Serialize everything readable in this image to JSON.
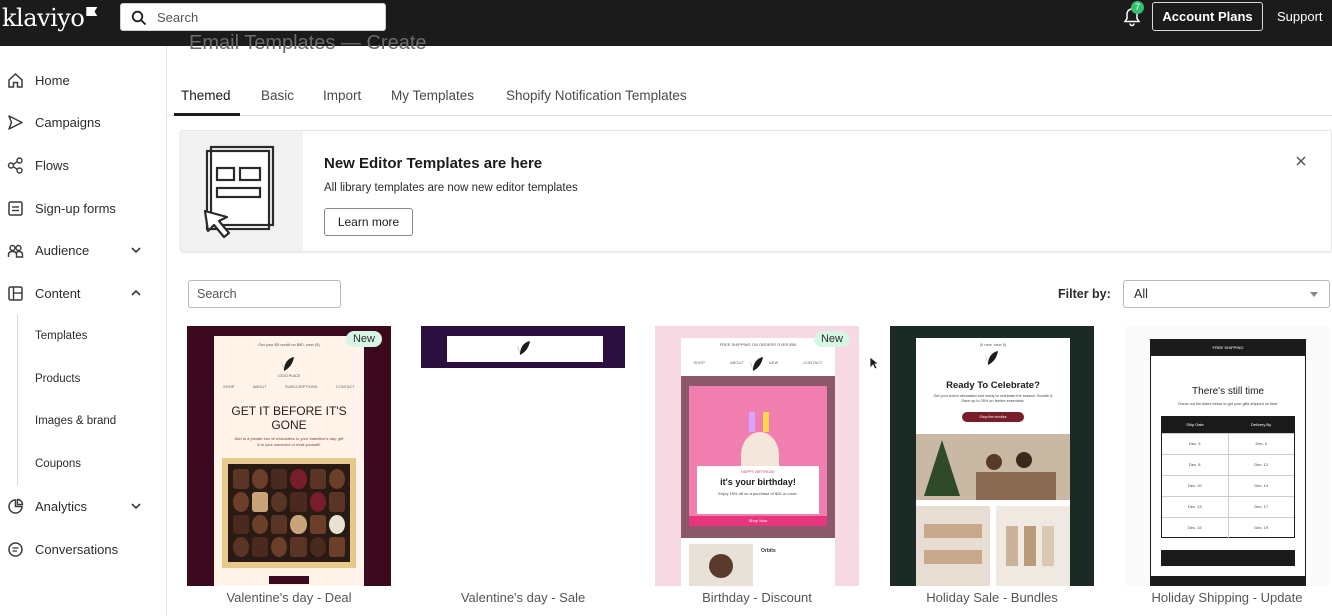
{
  "topbar": {
    "logo": "klaviyo",
    "search_placeholder": "Search",
    "notification_count": "7",
    "account_plans": "Account Plans",
    "support": "Support"
  },
  "sidebar": {
    "items": [
      {
        "label": "Home",
        "icon": "home-icon"
      },
      {
        "label": "Campaigns",
        "icon": "send-icon"
      },
      {
        "label": "Flows",
        "icon": "flows-icon"
      },
      {
        "label": "Sign-up forms",
        "icon": "form-icon"
      },
      {
        "label": "Audience",
        "icon": "audience-icon"
      },
      {
        "label": "Content",
        "icon": "content-icon"
      },
      {
        "label": "Analytics",
        "icon": "analytics-icon"
      },
      {
        "label": "Conversations",
        "icon": "chat-icon"
      }
    ],
    "content_sub": [
      "Templates",
      "Products",
      "Images & brand",
      "Coupons"
    ]
  },
  "page": {
    "heading": "Email Templates — Create"
  },
  "tabs": [
    "Themed",
    "Basic",
    "Import",
    "My Templates",
    "Shopify Notification Templates"
  ],
  "banner": {
    "title": "New Editor Templates are here",
    "subtitle": "All library templates are now new editor templates",
    "button": "Learn more"
  },
  "filters": {
    "search_placeholder": "Search",
    "filter_label": "Filter by:",
    "filter_value": "All"
  },
  "templates": [
    {
      "name": "Valentine's day - Deal",
      "badge": "New",
      "top_text": "Get your $5 credit on $60, view (5)",
      "brand": "LOGO PLACE",
      "nav": [
        "SHOP",
        "ABOUT",
        "SUBSCRIPTIONS",
        "CONTACT"
      ],
      "headline": "GET IT BEFORE IT'S GONE",
      "body": "Add to a private box of chocolates to your Valentine's day; gift it to your someone or treat yourself!"
    },
    {
      "name": "Valentine's day - Sale",
      "badge": ""
    },
    {
      "name": "Birthday - Discount",
      "badge": "New",
      "top_text": "FREE SHIPPING ON ORDERS OVER $50",
      "nav": [
        "SHOP",
        "ABOUT",
        "NEW",
        "CONTACT"
      ],
      "headline": "it's your birthday!",
      "kicker": "HAPPY BIRTHDAY",
      "body": "Enjoy 15% off on a purchase of $25 or more.",
      "cta": "Shop Now",
      "product": "Orbits"
    },
    {
      "name": "Holiday Sale - Bundles",
      "badge": "",
      "top_text": "(5 new, view 5)",
      "headline": "Ready To Celebrate?",
      "body": "Get your home decorated and ready to celebrate the season. Bundle & Save up to 25% on festive essentials.",
      "cta": "Shop the bundles"
    },
    {
      "name": "Holiday Shipping - Update",
      "badge": "",
      "top_text": "FREE SHIPPING",
      "headline": "There's still time",
      "body": "Check out the dates below to get your gifts shipped on time.",
      "table_head": [
        "Ship Date",
        "Delivery By"
      ],
      "table_rows": [
        [
          "Dec. 5",
          "Dec. 9"
        ],
        [
          "Dec. 8",
          "Dec. 12"
        ],
        [
          "Dec. 10",
          "Dec. 14"
        ],
        [
          "Dec. 13",
          "Dec. 17"
        ],
        [
          "Dec. 15",
          "Dec. 19"
        ]
      ]
    }
  ],
  "colors": {
    "topbar": "#1b1b1b",
    "new_badge": "#d7f5e4",
    "notification": "#34c16f"
  }
}
